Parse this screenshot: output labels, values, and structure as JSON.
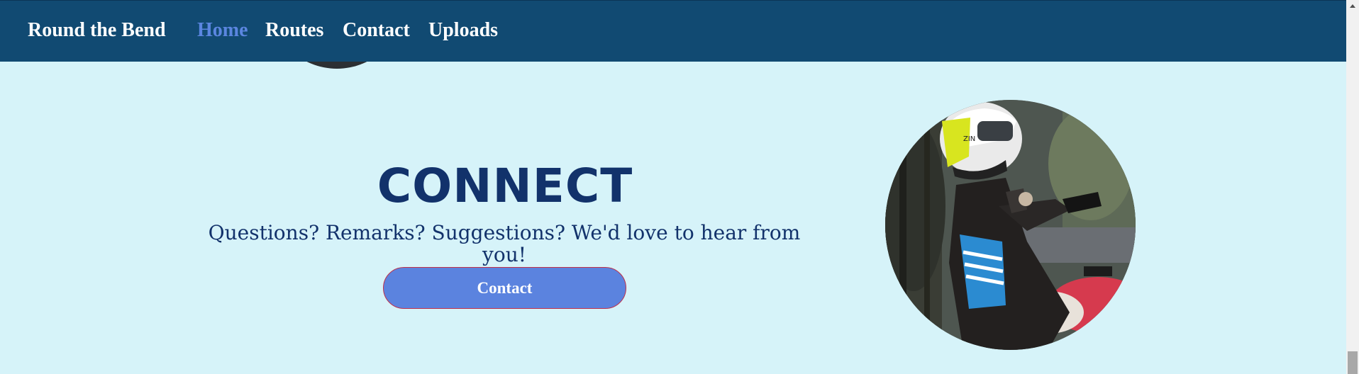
{
  "nav": {
    "brand": "Round the Bend",
    "links": [
      {
        "label": "Home",
        "active": true
      },
      {
        "label": "Routes",
        "active": false
      },
      {
        "label": "Contact",
        "active": false
      },
      {
        "label": "Uploads",
        "active": false
      }
    ]
  },
  "connect": {
    "heading": "CONNECT",
    "subtext": "Questions? Remarks? Suggestions? We'd love to hear from you!",
    "button_label": "Contact"
  },
  "colors": {
    "navbar": "#114a72",
    "background": "#d6f3f9",
    "heading": "#12326b",
    "active_link": "#5b86e0",
    "button": "#5b83df"
  },
  "icons": {
    "scroll_up": "chevron-up-icon"
  }
}
